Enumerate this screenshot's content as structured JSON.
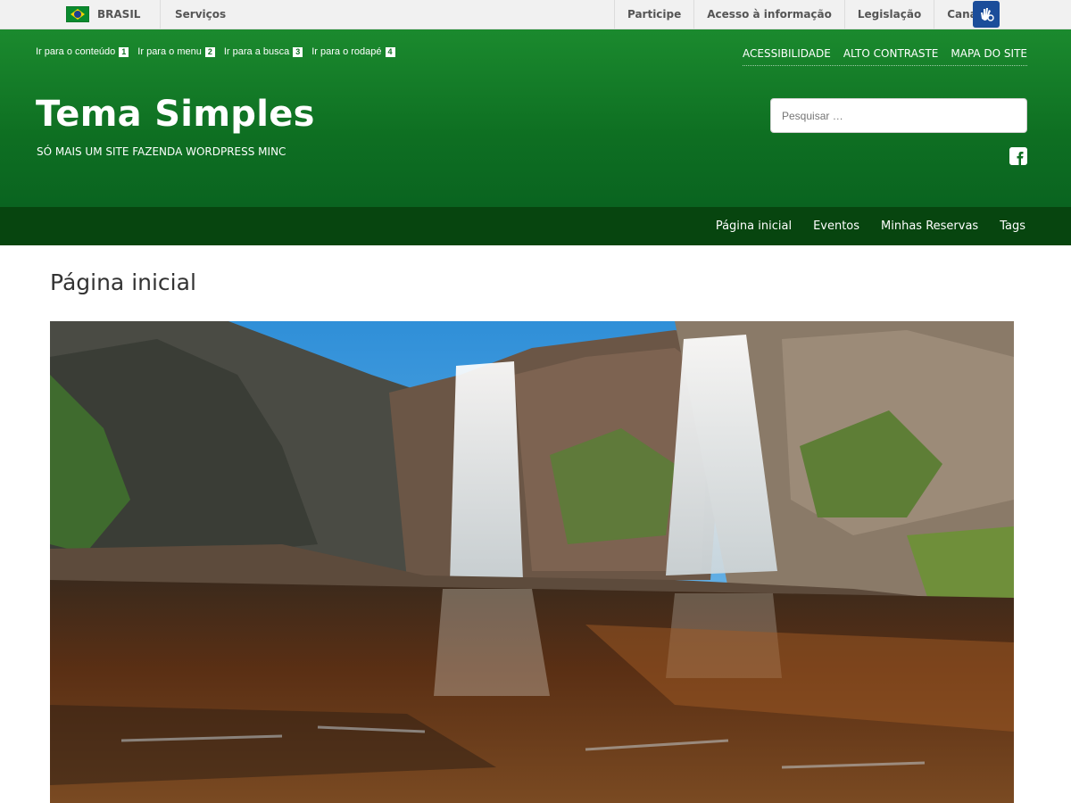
{
  "gov_bar": {
    "brand": "BRASIL",
    "services": "Serviços",
    "links": [
      "Participe",
      "Acesso à informação",
      "Legislação",
      "Canais"
    ]
  },
  "header": {
    "skip_links": [
      {
        "label": "Ir para o conteúdo",
        "key": "1"
      },
      {
        "label": "Ir para o menu",
        "key": "2"
      },
      {
        "label": "Ir para a busca",
        "key": "3"
      },
      {
        "label": "Ir para o rodapé",
        "key": "4"
      }
    ],
    "accessibility_links": [
      "ACESSIBILIDADE",
      "ALTO CONTRASTE",
      "MAPA DO SITE"
    ],
    "site_title": "Tema Simples",
    "site_description": "SÓ MAIS UM SITE FAZENDA WORDPRESS MINC",
    "search_placeholder": "Pesquisar …"
  },
  "nav": {
    "items": [
      "Página inicial",
      "Eventos",
      "Minhas Reservas",
      "Tags"
    ]
  },
  "content": {
    "page_title": "Página inicial",
    "hero_image": "waterfall-photo"
  },
  "colors": {
    "header_green": "#1b8a2e",
    "nav_green": "#07450f",
    "gov_bar": "#f1f1f1"
  }
}
